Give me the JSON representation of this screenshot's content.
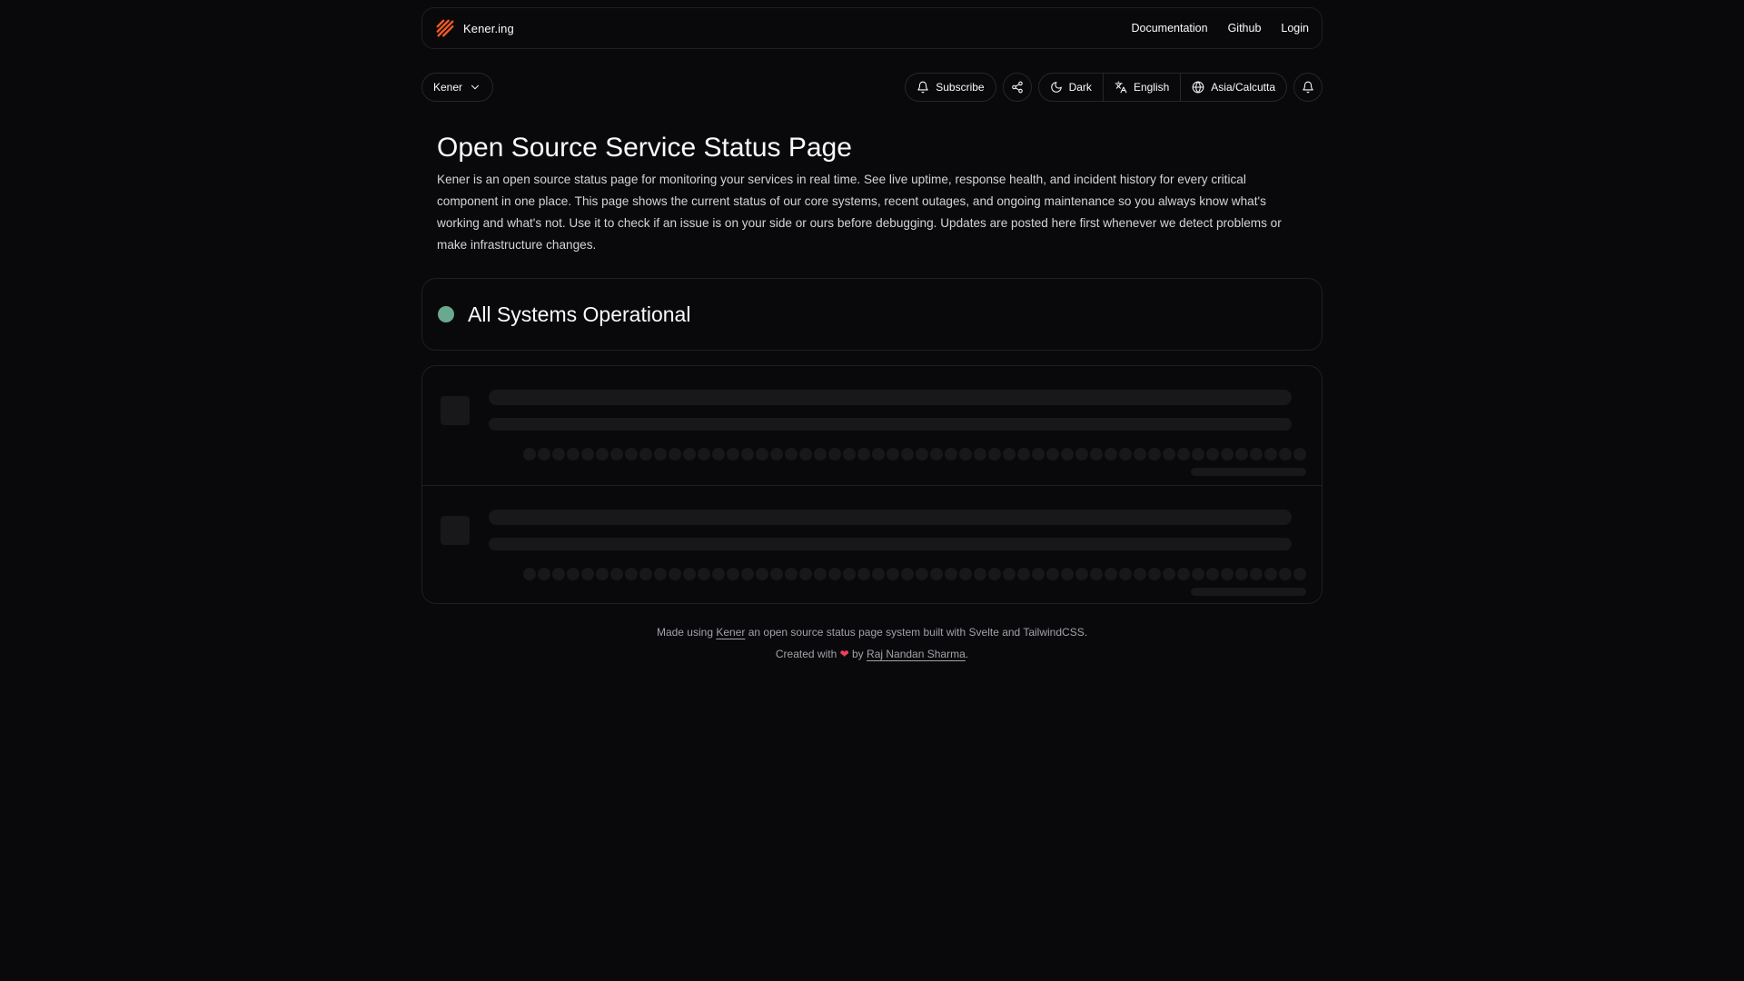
{
  "nav": {
    "brand": "Kener.ing",
    "links": [
      "Documentation",
      "Github",
      "Login"
    ]
  },
  "toolbar": {
    "selector_label": "Kener",
    "subscribe_label": "Subscribe",
    "theme_label": "Dark",
    "language_label": "English",
    "timezone_label": "Asia/Calcutta"
  },
  "hero": {
    "title": "Open Source Service Status Page",
    "description": "Kener is an open source status page for monitoring your services in real time. See live uptime, response health, and incident history for every critical component in one place. This page shows the current status of our core systems, recent outages, and ongoing maintenance so you always know what's working and what's not. Use it to check if an issue is on your side or ours before debugging. Updates are posted here first whenever we detect problems or make infrastructure changes."
  },
  "status": {
    "text": "All Systems Operational",
    "color": "#6ba890"
  },
  "footer": {
    "line1_prefix": "Made using",
    "line1_link": "Kener",
    "line1_suffix": "an open source status page system built with Svelte and TailwindCSS.",
    "line2_prefix": "Created with",
    "line2_by": "by",
    "line2_link": "Raj Nandan Sharma",
    "line2_end": "."
  },
  "icons": {
    "logo": "kener-logo-icon",
    "chevron": "chevron-down-icon",
    "bell": "bell-icon",
    "share": "share-icon",
    "moon": "moon-icon",
    "translate": "translate-icon",
    "globe": "globe-icon",
    "heart": "heart-icon"
  }
}
